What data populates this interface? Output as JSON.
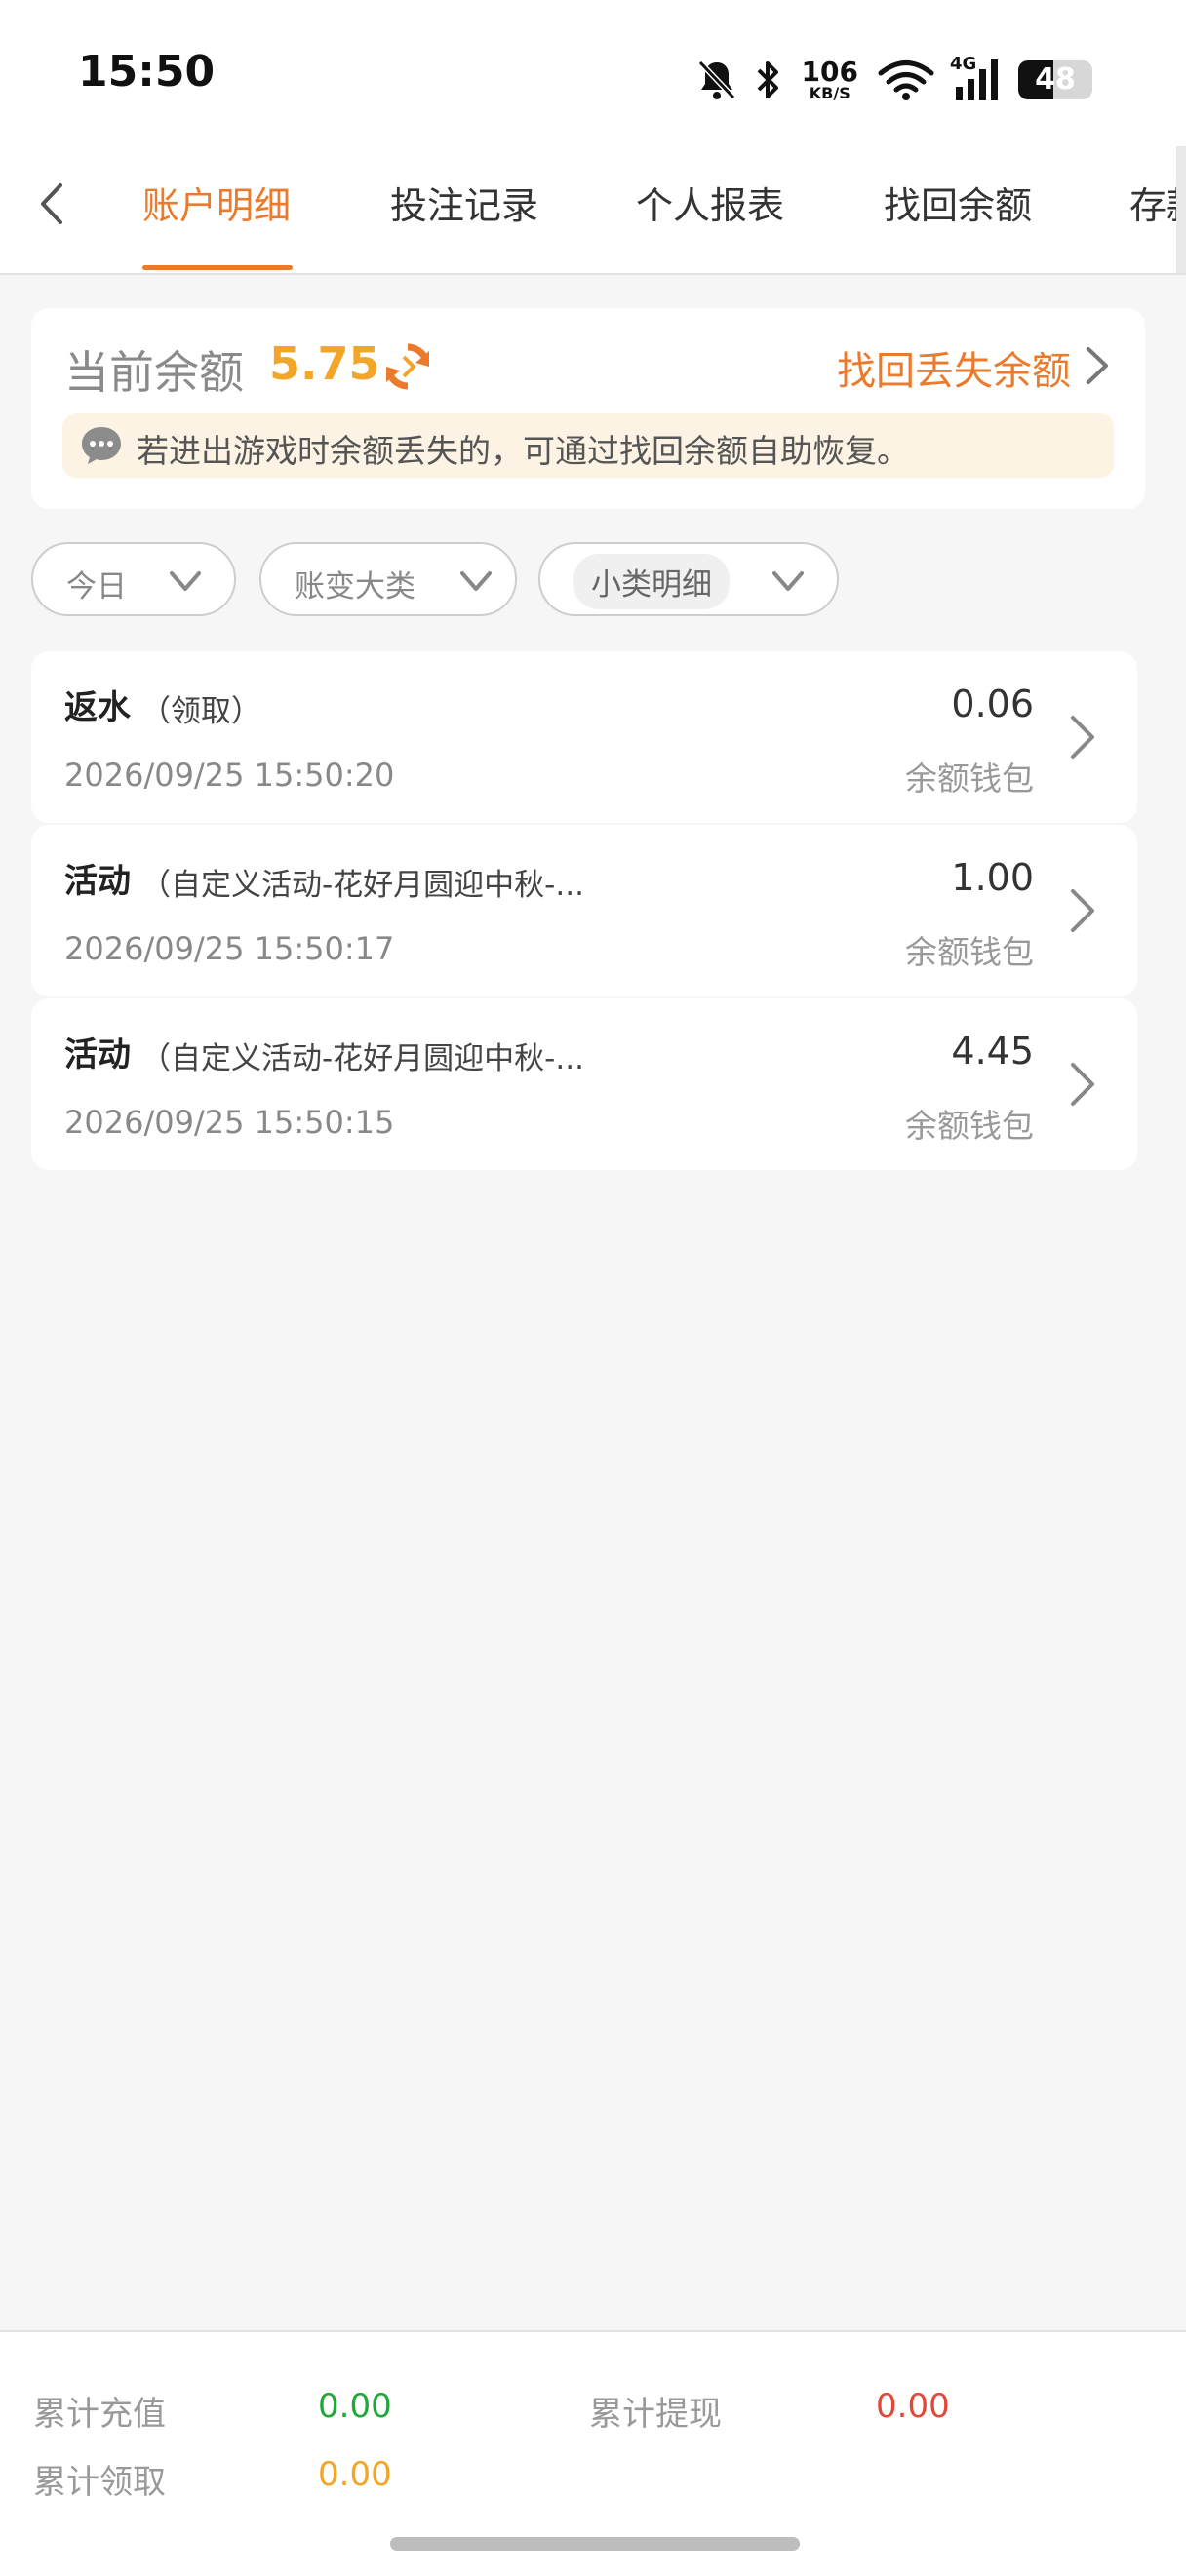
{
  "status_bar": {
    "time": "15:50",
    "net_speed": "106",
    "net_unit": "KB/S",
    "network_type": "4G",
    "battery_level": "48",
    "battery_fraction": 0.48,
    "icons": [
      "bell-mute-icon",
      "bluetooth-icon",
      "wifi-icon",
      "signal-icon",
      "battery-icon"
    ]
  },
  "nav": {
    "back_icon": "chevron-left-icon",
    "tabs": [
      {
        "label": "账户明细",
        "active": true
      },
      {
        "label": "投注记录",
        "active": false
      },
      {
        "label": "个人报表",
        "active": false
      },
      {
        "label": "找回余额",
        "active": false
      },
      {
        "label": "存款",
        "active": false
      }
    ]
  },
  "balance": {
    "label": "当前余额",
    "value": "5.75",
    "refresh_icon": "refresh-icon",
    "recover_label": "找回丢失余额",
    "notice": "若进出游戏时余额丢失的，可通过找回余额自助恢复。"
  },
  "filters": [
    {
      "label": "今日"
    },
    {
      "label": "账变大类"
    },
    {
      "label": "小类明细"
    }
  ],
  "records": [
    {
      "type": "返水",
      "detail": "（领取）",
      "time": "2026/09/25 15:50:20",
      "amount": "0.06",
      "wallet": "余额钱包"
    },
    {
      "type": "活动",
      "detail": "（自定义活动-花好月圆迎中秋-...",
      "time": "2026/09/25 15:50:17",
      "amount": "1.00",
      "wallet": "余额钱包"
    },
    {
      "type": "活动",
      "detail": "（自定义活动-花好月圆迎中秋-...",
      "time": "2026/09/25 15:50:15",
      "amount": "4.45",
      "wallet": "余额钱包"
    }
  ],
  "summary": {
    "recharge_label": "累计充值",
    "recharge_value": "0.00",
    "withdraw_label": "累计提现",
    "withdraw_value": "0.00",
    "claim_label": "累计领取",
    "claim_value": "0.00"
  },
  "colors": {
    "accent": "#ec7a2c",
    "balance": "#f2a526",
    "recharge": "#22a83a",
    "withdraw": "#e0483a",
    "claim": "#f2a526"
  }
}
